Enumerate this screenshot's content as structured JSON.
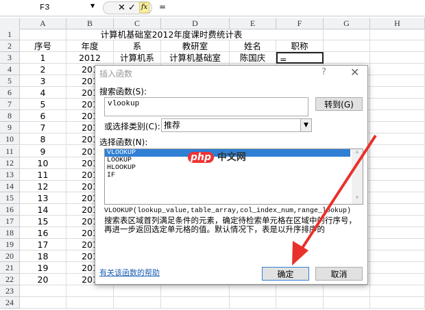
{
  "formula_bar": {
    "name_box": "F3",
    "cancel": "✕",
    "enter": "✓",
    "fx": "fx",
    "value": "="
  },
  "columns": [
    "A",
    "B",
    "C",
    "D",
    "E",
    "F",
    "G",
    "H"
  ],
  "sheet": {
    "title": "计算机基础室2012年度课时费统计表",
    "headers": [
      "序号",
      "年度",
      "系",
      "教研室",
      "姓名",
      "职称"
    ],
    "row3": [
      "1",
      "2012",
      "计算机系",
      "计算机基础室",
      "陈国庆",
      "="
    ],
    "seq": [
      "2",
      "3",
      "4",
      "5",
      "6",
      "7",
      "8",
      "9",
      "10",
      "11",
      "12",
      "13",
      "14",
      "15",
      "16",
      "17",
      "18",
      "19",
      "20"
    ],
    "year_partial": "201"
  },
  "dialog": {
    "title": "插入函数",
    "help": "?",
    "close": "✕",
    "search_label": "搜索函数(S):",
    "search_value": "vlookup",
    "goto_button": "转到(G)",
    "category_label": "或选择类别(C):",
    "category_value": "推荐",
    "select_label": "选择函数(N):",
    "functions": [
      "VLOOKUP",
      "LOOKUP",
      "HLOOKUP",
      "IF"
    ],
    "signature": "VLOOKUP(lookup_value,table_array,col_index_num,range_lookup)",
    "description": "搜索表区域首列满足条件的元素，确定待检索单元格在区域中的行序号，再进一步返回选定单元格的值。默认情况下，表是以升序排序的",
    "help_link": "有关该函数的帮助",
    "ok": "确定",
    "cancel": "取消"
  },
  "watermark": {
    "logo": "php",
    "text": "中文网"
  },
  "annotation_color": "#e8312a"
}
